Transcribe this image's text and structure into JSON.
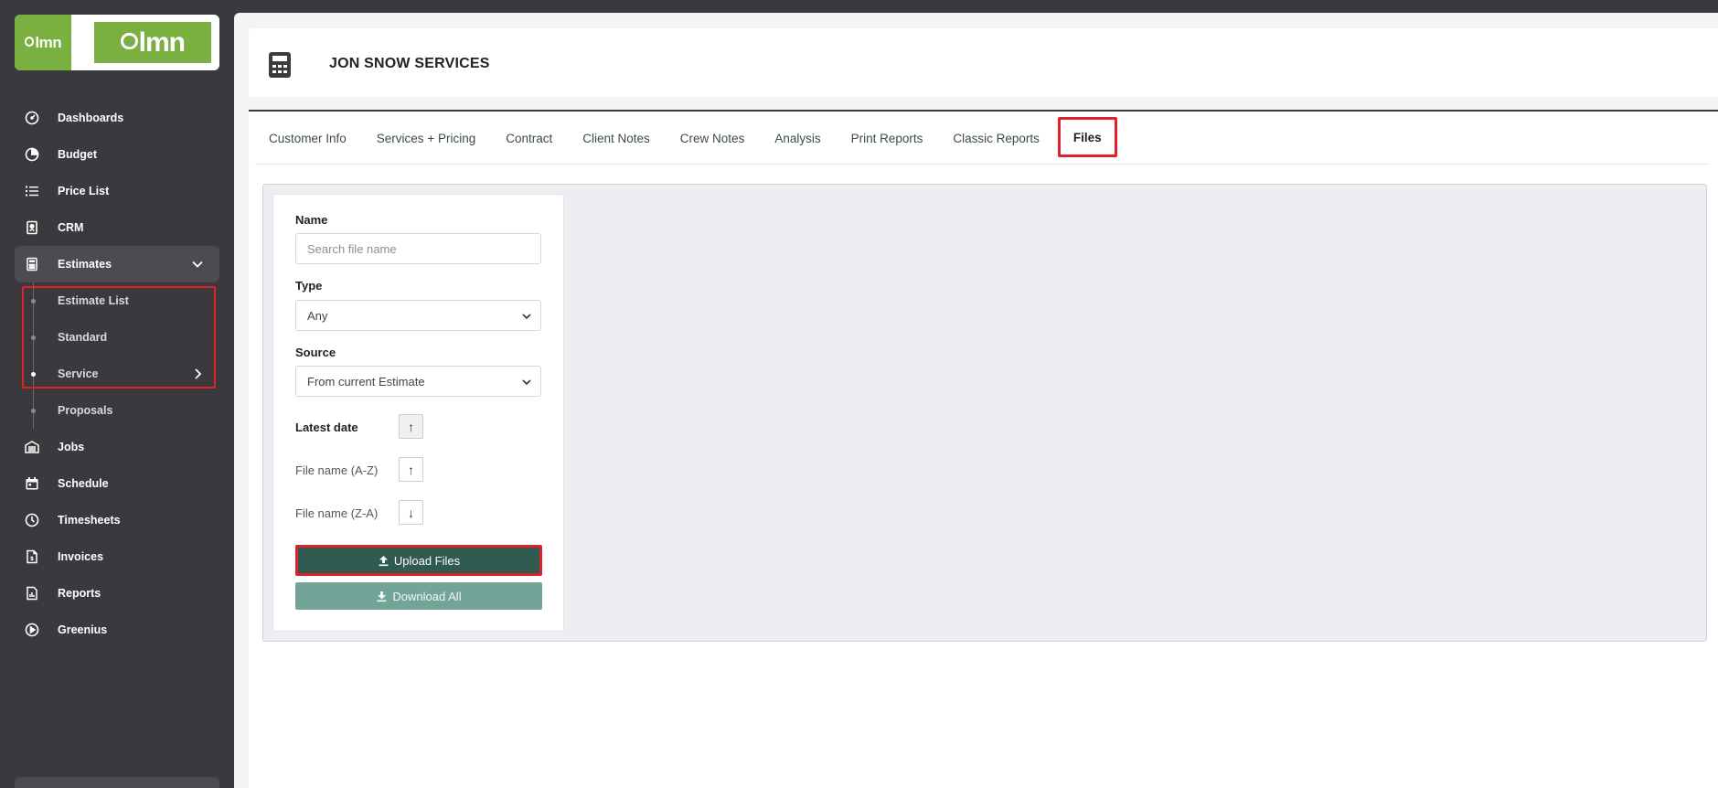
{
  "sidebar": {
    "logo_small_text": "lmn",
    "logo_big_text": "lmn",
    "items": [
      {
        "label": "Dashboards",
        "icon": "gauge-icon"
      },
      {
        "label": "Budget",
        "icon": "pie-chart-icon"
      },
      {
        "label": "Price List",
        "icon": "list-icon"
      },
      {
        "label": "CRM",
        "icon": "contact-card-icon"
      },
      {
        "label": "Estimates",
        "icon": "calculator-icon"
      },
      {
        "label": "Jobs",
        "icon": "garage-icon"
      },
      {
        "label": "Schedule",
        "icon": "calendar-icon"
      },
      {
        "label": "Timesheets",
        "icon": "clock-icon"
      },
      {
        "label": "Invoices",
        "icon": "invoice-icon"
      },
      {
        "label": "Reports",
        "icon": "report-icon"
      },
      {
        "label": "Greenius",
        "icon": "play-circle-icon"
      }
    ],
    "estimates_sub": [
      {
        "label": "Estimate List"
      },
      {
        "label": "Standard"
      },
      {
        "label": "Service"
      },
      {
        "label": "Proposals"
      }
    ]
  },
  "header": {
    "title": "JON SNOW SERVICES"
  },
  "tabs": [
    {
      "label": "Customer Info"
    },
    {
      "label": "Services + Pricing"
    },
    {
      "label": "Contract"
    },
    {
      "label": "Client Notes"
    },
    {
      "label": "Crew Notes"
    },
    {
      "label": "Analysis"
    },
    {
      "label": "Print Reports"
    },
    {
      "label": "Classic Reports"
    },
    {
      "label": "Files"
    }
  ],
  "filters": {
    "name_label": "Name",
    "name_placeholder": "Search file name",
    "name_value": "",
    "type_label": "Type",
    "type_value": "Any",
    "source_label": "Source",
    "source_value": "From current Estimate",
    "sort": [
      {
        "label": "Latest date",
        "arrow": "↑"
      },
      {
        "label": "File name (A-Z)",
        "arrow": "↑"
      },
      {
        "label": "File name (Z-A)",
        "arrow": "↓"
      }
    ],
    "upload_label": "Upload Files",
    "download_label": "Download All"
  },
  "colors": {
    "sidebar_bg": "#3a3a3e",
    "brand_green": "#7ab040",
    "upload_bg": "#2f5a4f",
    "download_bg": "#72a597",
    "highlight_red": "#e0202a"
  }
}
